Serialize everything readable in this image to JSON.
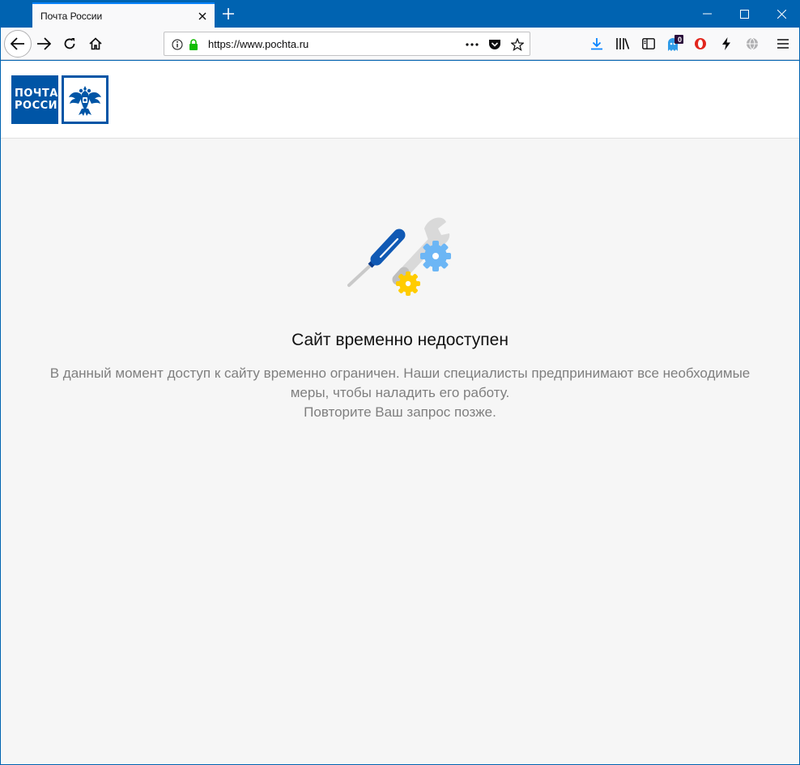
{
  "browser": {
    "tab_title": "Почта России",
    "url": "https://www.pochta.ru",
    "downloads_badge": "0"
  },
  "site": {
    "logo_line1": "ПОЧТА",
    "logo_line2": "РОССИИ"
  },
  "message": {
    "title": "Сайт временно недоступен",
    "line1": "В данный момент доступ к сайту временно ограничен. Наши специалисты предпринимают все необходимые",
    "line2": "меры, чтобы наладить его работу.",
    "line3": "Повторите Ваш запрос позже."
  },
  "widget": {
    "counter": "0"
  },
  "colors": {
    "brand_blue": "#0055a6",
    "gear_blue": "#6cb6f5",
    "gear_yellow": "#ffcc00",
    "badge_purple": "#5b0a60"
  }
}
